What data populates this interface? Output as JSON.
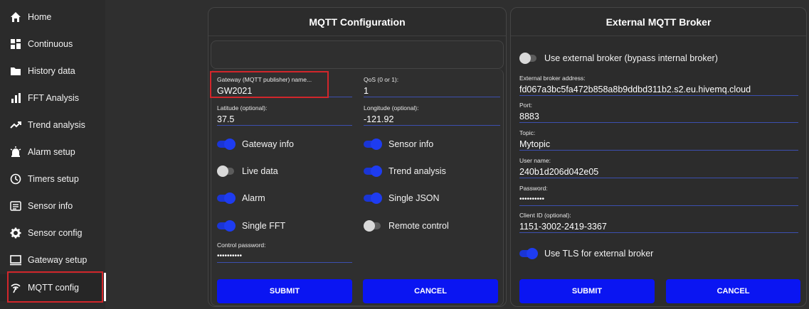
{
  "sidebar": {
    "items": [
      {
        "label": "Home",
        "icon": "home-icon"
      },
      {
        "label": "Continuous",
        "icon": "grid-icon"
      },
      {
        "label": "History data",
        "icon": "folder-icon"
      },
      {
        "label": "FFT Analysis",
        "icon": "bar-chart-icon"
      },
      {
        "label": "Trend analysis",
        "icon": "trend-icon"
      },
      {
        "label": "Alarm setup",
        "icon": "alarm-icon"
      },
      {
        "label": "Timers setup",
        "icon": "clock-icon"
      },
      {
        "label": "Sensor info",
        "icon": "list-icon"
      },
      {
        "label": "Sensor config",
        "icon": "gear-icon"
      },
      {
        "label": "Gateway setup",
        "icon": "monitor-icon"
      },
      {
        "label": "MQTT config",
        "icon": "antenna-icon"
      }
    ],
    "active": "MQTT config"
  },
  "mqtt_panel": {
    "title": "MQTT Configuration",
    "gateway_name": {
      "label": "Gateway (MQTT publisher) name...",
      "value": "GW2021"
    },
    "qos": {
      "label": "QoS (0 or 1):",
      "value": "1"
    },
    "latitude": {
      "label": "Latitude (optional):",
      "value": "37.5"
    },
    "longitude": {
      "label": "Longitude (optional):",
      "value": "-121.92"
    },
    "toggles": {
      "gateway_info": {
        "label": "Gateway info",
        "on": true
      },
      "sensor_info": {
        "label": "Sensor info",
        "on": true
      },
      "live_data": {
        "label": "Live data",
        "on": false
      },
      "trend_analysis": {
        "label": "Trend analysis",
        "on": true
      },
      "alarm": {
        "label": "Alarm",
        "on": true
      },
      "single_json": {
        "label": "Single JSON",
        "on": true
      },
      "single_fft": {
        "label": "Single FFT",
        "on": true
      },
      "remote_control": {
        "label": "Remote control",
        "on": false
      }
    },
    "control_password": {
      "label": "Control password:",
      "value": "••••••••••"
    },
    "submit_label": "SUBMIT",
    "cancel_label": "CANCEL"
  },
  "broker_panel": {
    "title": "External MQTT Broker",
    "use_external": {
      "label": "Use external broker (bypass internal broker)",
      "on": false
    },
    "address": {
      "label": "External broker address:",
      "value": "fd067a3bc5fa472b858a8b9ddbd311b2.s2.eu.hivemq.cloud"
    },
    "port": {
      "label": "Port:",
      "value": "8883"
    },
    "topic": {
      "label": "Topic:",
      "value": "Mytopic"
    },
    "username": {
      "label": "User name:",
      "value": "240b1d206d042e05"
    },
    "password": {
      "label": "Password:",
      "value": "••••••••••"
    },
    "client_id": {
      "label": "Client ID (optional):",
      "value": "1151-3002-2419-3367"
    },
    "use_tls": {
      "label": "Use TLS for external broker",
      "on": true
    },
    "submit_label": "SUBMIT",
    "cancel_label": "CANCEL"
  },
  "colors": {
    "accent": "#0a15f2",
    "toggle_on": "#1e3cf0",
    "highlight": "#d2262b",
    "background": "#2f2f2f"
  }
}
